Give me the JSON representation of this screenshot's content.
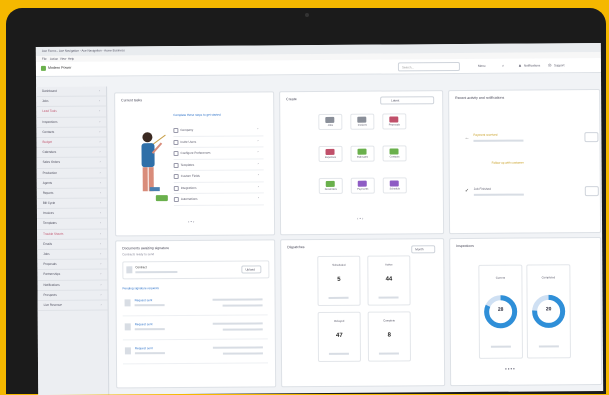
{
  "window": {
    "title": "Ace Forms - Ace Navigation - Ace Navigation - Acme Business",
    "menus": [
      "File",
      "Action",
      "View",
      "Help"
    ]
  },
  "app": {
    "brand": "Modern Power",
    "search_placeholder": "Search...",
    "menu_label": "Menu",
    "toolbar": [
      "Notifications",
      "Support"
    ]
  },
  "sidebar": {
    "items": [
      "Dashboard",
      "Jobs",
      "Lead Tools",
      "Inspections",
      "Contacts",
      "Budget",
      "Calendars",
      "Sales Orders",
      "Production",
      "Agents",
      "Reports",
      "Bill Cycle",
      "Invoices",
      "Templates",
      "Trouble Sheets",
      "Emails",
      "Jobs",
      "Proposals",
      "Partnerships",
      "Notifications",
      "Prospects",
      "Live Revenue"
    ],
    "highlight": [
      "Lead Tools",
      "Budget",
      "Trouble Sheets"
    ]
  },
  "tasks": {
    "title": "Current tasks",
    "heading": "Complete these steps to get started",
    "items": [
      "Company",
      "Invite Users",
      "Configure Preferences",
      "Templates",
      "Custom Fields",
      "Integrations",
      "Automations"
    ]
  },
  "quick": {
    "title": "Create",
    "filter": "Latest",
    "tiles": [
      {
        "label": "Jobs",
        "color": "#8a8f99"
      },
      {
        "label": "Invoices",
        "color": "#8a8f99"
      },
      {
        "label": "Proposals",
        "color": "#c0506a"
      },
      {
        "label": "Expenses",
        "color": "#c0506a"
      },
      {
        "label": "Estimates",
        "color": "#6ab04c"
      },
      {
        "label": "Contacts",
        "color": "#6ab04c"
      },
      {
        "label": "Reminders",
        "color": "#6ab04c"
      },
      {
        "label": "Payments",
        "color": "#8e5cc4"
      },
      {
        "label": "Schedule",
        "color": "#8e5cc4"
      }
    ]
  },
  "activity": {
    "title": "Recent activity and notifications",
    "item1": "Payment received",
    "action": "Follow up with customer",
    "item2": "Job Finished"
  },
  "documents": {
    "title": "Documents awaiting signature",
    "subtitle": "Contracts ready to send",
    "row": "Contract",
    "button": "Upload",
    "section": "Pending signature requests",
    "rows": [
      "Request sent",
      "Request sent",
      "Request sent"
    ]
  },
  "dispatch": {
    "title": "Dispatches",
    "filter": "Month",
    "stats": [
      {
        "label": "Scheduled",
        "value": "5"
      },
      {
        "label": "Active",
        "value": "44"
      },
      {
        "label": "Delayed",
        "value": "47"
      },
      {
        "label": "Complete",
        "value": "8"
      }
    ]
  },
  "progress": {
    "title": "Inspections",
    "donuts": [
      {
        "label": "Current",
        "value": "28",
        "fraction": 0.82
      },
      {
        "label": "Completed",
        "value": "20",
        "fraction": 0.76
      }
    ]
  }
}
